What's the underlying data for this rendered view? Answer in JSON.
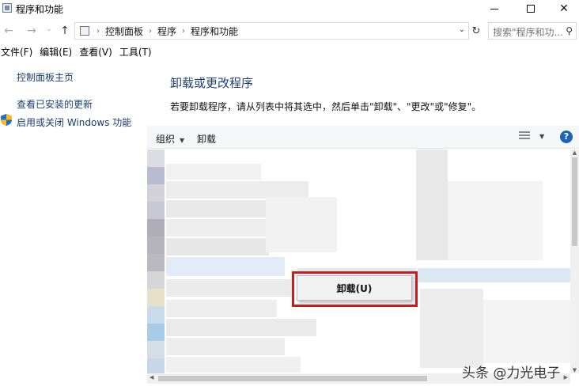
{
  "window": {
    "title": "程序和功能",
    "minimize": "—",
    "maximize": "☐",
    "close": "✕"
  },
  "addressbar": {
    "back_icon": "←",
    "forward_icon": "→",
    "history_icon": "⌄",
    "up_icon": "↑",
    "path": [
      "控制面板",
      "程序",
      "程序和功能"
    ],
    "separator": "›",
    "refresh_icon": "↻",
    "search_placeholder": "搜索\"程序和功..."
  },
  "menubar": {
    "items": [
      "文件(F)",
      "编辑(E)",
      "查看(V)",
      "工具(T)"
    ]
  },
  "leftpane": {
    "home": "控制面板主页",
    "updates": "查看已安装的更新",
    "features": "启用或关闭 Windows 功能"
  },
  "main": {
    "title": "卸载或更改程序",
    "description": "若要卸载程序，请从列表中将其选中，然后单击\"卸载\"、\"更改\"或\"修复\"。"
  },
  "toolbar": {
    "organize": "组织",
    "uninstall": "卸载",
    "help": "?"
  },
  "context_menu": {
    "uninstall": "卸载(U)"
  },
  "watermark": "头条 @力光电子",
  "colors": {
    "accent_link": "#1a3d6e",
    "title": "#1e3f78",
    "highlight_frame": "#d0191b",
    "help_button": "#1e63b7"
  }
}
